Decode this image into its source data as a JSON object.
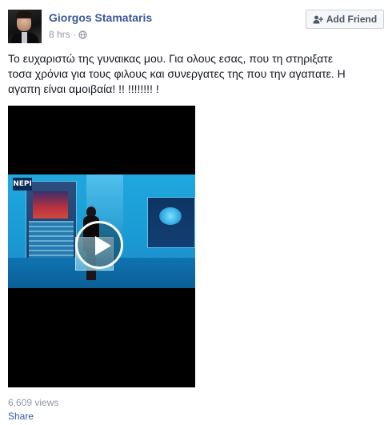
{
  "author": {
    "name": "Giorgos Stamataris",
    "avatar_alt": "profile-photo"
  },
  "meta": {
    "time": "8 hrs",
    "separator": "·",
    "privacy_icon": "globe-icon"
  },
  "add_friend": {
    "label": "Add Friend",
    "icon": "add-friend-icon"
  },
  "post_text": {
    "line1": "Το ευχαριστώ της γυναικας μου. Για ολους εσας, που τη στηριξατε",
    "line2": "τοσα χρόνια για τους φιλους και συνεργατες της που την αγαπατε. Η",
    "line3": "αγαπη είναι αμοιβαία! !! !!!!!!!! !"
  },
  "video": {
    "channel_logo": "ΝΕΡΙ",
    "play_icon": "play-icon",
    "accent": "#1fa8de"
  },
  "footer": {
    "views": "6,609 views",
    "share": "Share"
  },
  "colors": {
    "link": "#3b5998",
    "muted": "#9197a3",
    "text": "#141823"
  }
}
